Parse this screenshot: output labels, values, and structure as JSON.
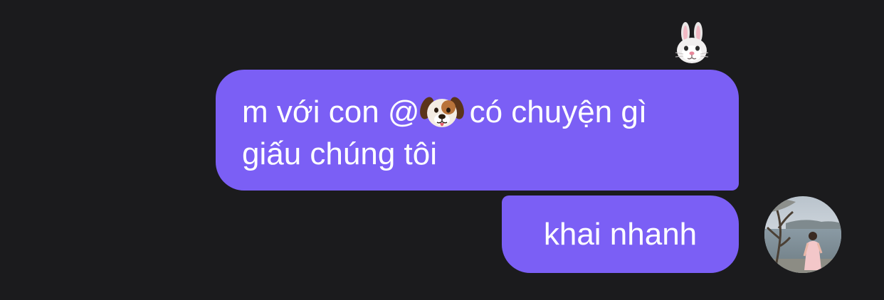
{
  "reaction": {
    "icon": "rabbit-face-icon"
  },
  "messages": [
    {
      "line1_before": "m với con @",
      "mention_icon": "dog-face-icon",
      "line1_after": "có chuyện gì",
      "line2": "giấu chúng tôi"
    },
    {
      "text": "khai nhanh"
    }
  ],
  "avatar": {
    "icon": "user-avatar-photo"
  },
  "colors": {
    "background": "#1b1b1d",
    "bubble": "#7b5ff5",
    "text": "#ffffff"
  }
}
